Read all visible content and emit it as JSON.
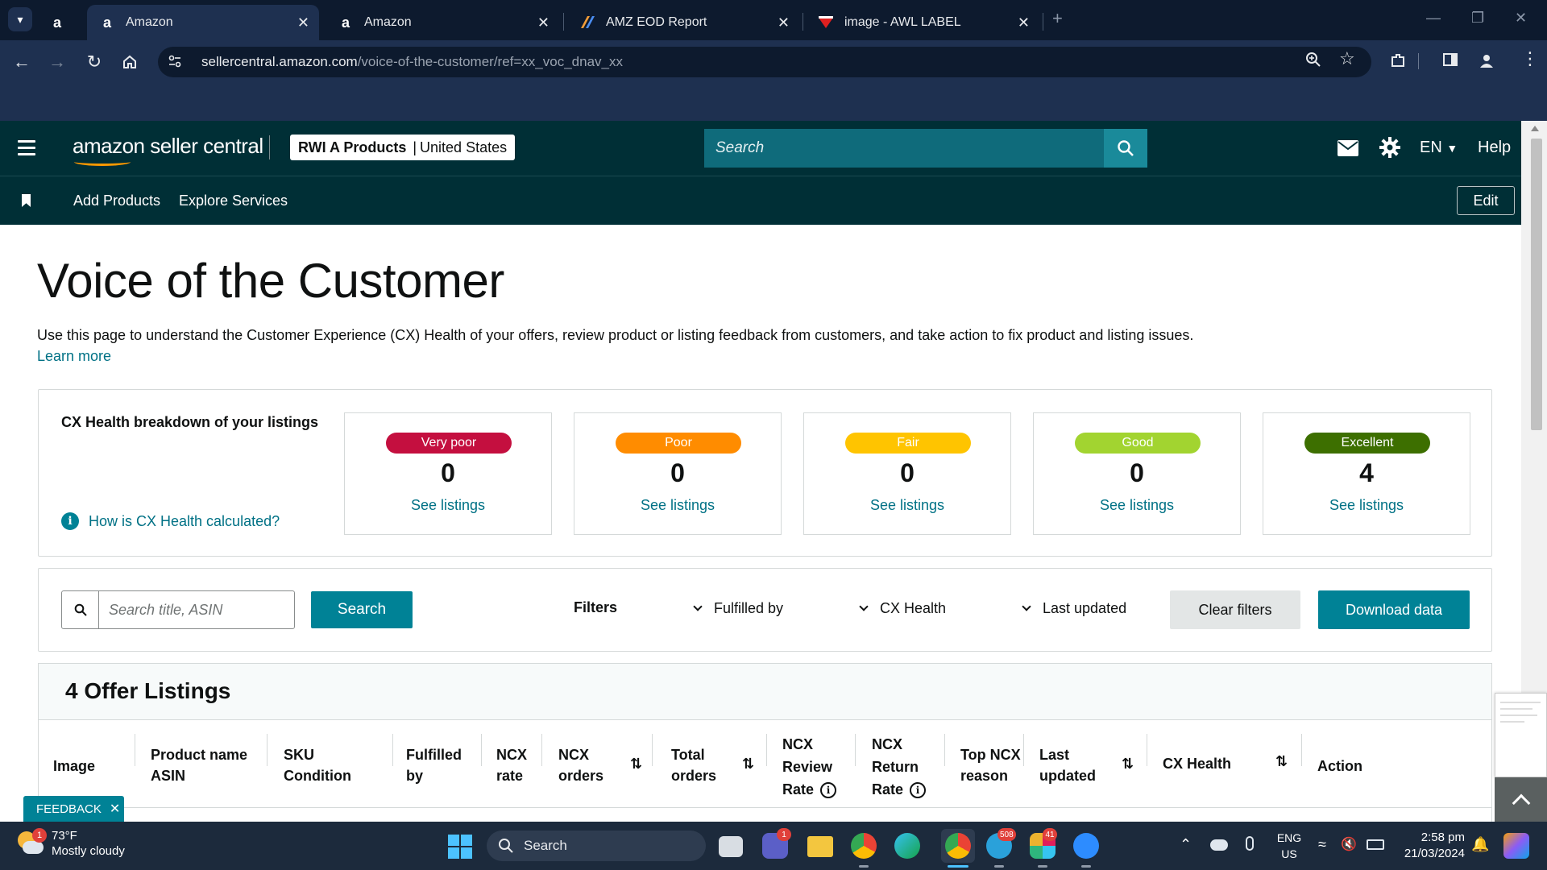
{
  "browser": {
    "tabs": [
      {
        "title": "",
        "icon": "amazon-icon"
      },
      {
        "title": "Amazon",
        "icon": "amazon-icon"
      },
      {
        "title": "Amazon",
        "icon": "amazon-icon"
      },
      {
        "title": "AMZ EOD Report",
        "icon": "report-icon"
      },
      {
        "title": "image - AWL LABEL",
        "icon": "label-icon"
      }
    ],
    "url_host": "sellercentral.amazon.com",
    "url_path": "/voice-of-the-customer/ref=xx_voc_dnav_xx"
  },
  "header": {
    "logo_text": "amazon seller central",
    "account_name": "RWI A Products",
    "account_sep": "|",
    "account_region": "United States",
    "search_placeholder": "Search",
    "language": "EN",
    "help_label": "Help"
  },
  "subnav": {
    "links": [
      "Add Products",
      "Explore Services"
    ],
    "edit_label": "Edit"
  },
  "page": {
    "title": "Voice of the Customer",
    "description": "Use this page to understand the Customer Experience (CX) Health of your offers, review product or listing feedback from customers, and take action to fix product and listing issues.",
    "learn_more": "Learn more"
  },
  "cx_health": {
    "heading": "CX Health breakdown of your listings",
    "how_calculated": "How is CX Health calculated?",
    "categories": [
      {
        "label": "Very poor",
        "count": "0",
        "link": "See listings",
        "color": "#c40f3f",
        "text_color": "#ffffff"
      },
      {
        "label": "Poor",
        "count": "0",
        "link": "See listings",
        "color": "#ff8c00",
        "text_color": "#ffffff"
      },
      {
        "label": "Fair",
        "count": "0",
        "link": "See listings",
        "color": "#ffc400",
        "text_color": "#ffffff"
      },
      {
        "label": "Good",
        "count": "0",
        "link": "See listings",
        "color": "#a2d430",
        "text_color": "#ffffff"
      },
      {
        "label": "Excellent",
        "count": "4",
        "link": "See listings",
        "color": "#3d6f00",
        "text_color": "#ffffff"
      }
    ]
  },
  "filters": {
    "search_placeholder": "Search title, ASIN",
    "search_button": "Search",
    "filters_label": "Filters",
    "dropdowns": [
      "Fulfilled by",
      "CX Health",
      "Last updated"
    ],
    "clear_button": "Clear filters",
    "download_button": "Download data"
  },
  "listings": {
    "title": "4 Offer Listings",
    "columns": [
      {
        "line1": "Image",
        "line2": ""
      },
      {
        "line1": "Product name",
        "line2": "ASIN"
      },
      {
        "line1": "SKU",
        "line2": "Condition"
      },
      {
        "line1": "Fulfilled",
        "line2": "by"
      },
      {
        "line1": "NCX",
        "line2": "rate"
      },
      {
        "line1": "NCX",
        "line2": "orders"
      },
      {
        "line1": "Total",
        "line2": "orders"
      },
      {
        "line1": "NCX",
        "line2": "Review",
        "line3": "Rate"
      },
      {
        "line1": "NCX",
        "line2": "Return",
        "line3": "Rate"
      },
      {
        "line1": "Top NCX",
        "line2": "reason"
      },
      {
        "line1": "Last",
        "line2": "updated"
      },
      {
        "line1": "CX Health",
        "line2": ""
      },
      {
        "line1": "Action",
        "line2": ""
      }
    ]
  },
  "feedback": {
    "label": "FEEDBACK"
  },
  "taskbar": {
    "temperature": "73°F",
    "weather": "Mostly cloudy",
    "weather_badge": "1",
    "search_label": "Search",
    "teams_badge": "1",
    "telegram_badge": "508",
    "slack_badge": "41",
    "lang_line1": "ENG",
    "lang_line2": "US",
    "time": "2:58 pm",
    "date": "21/03/2024"
  },
  "colors": {
    "header_bg": "#002f36",
    "accent_teal": "#008296",
    "link": "#007185"
  }
}
